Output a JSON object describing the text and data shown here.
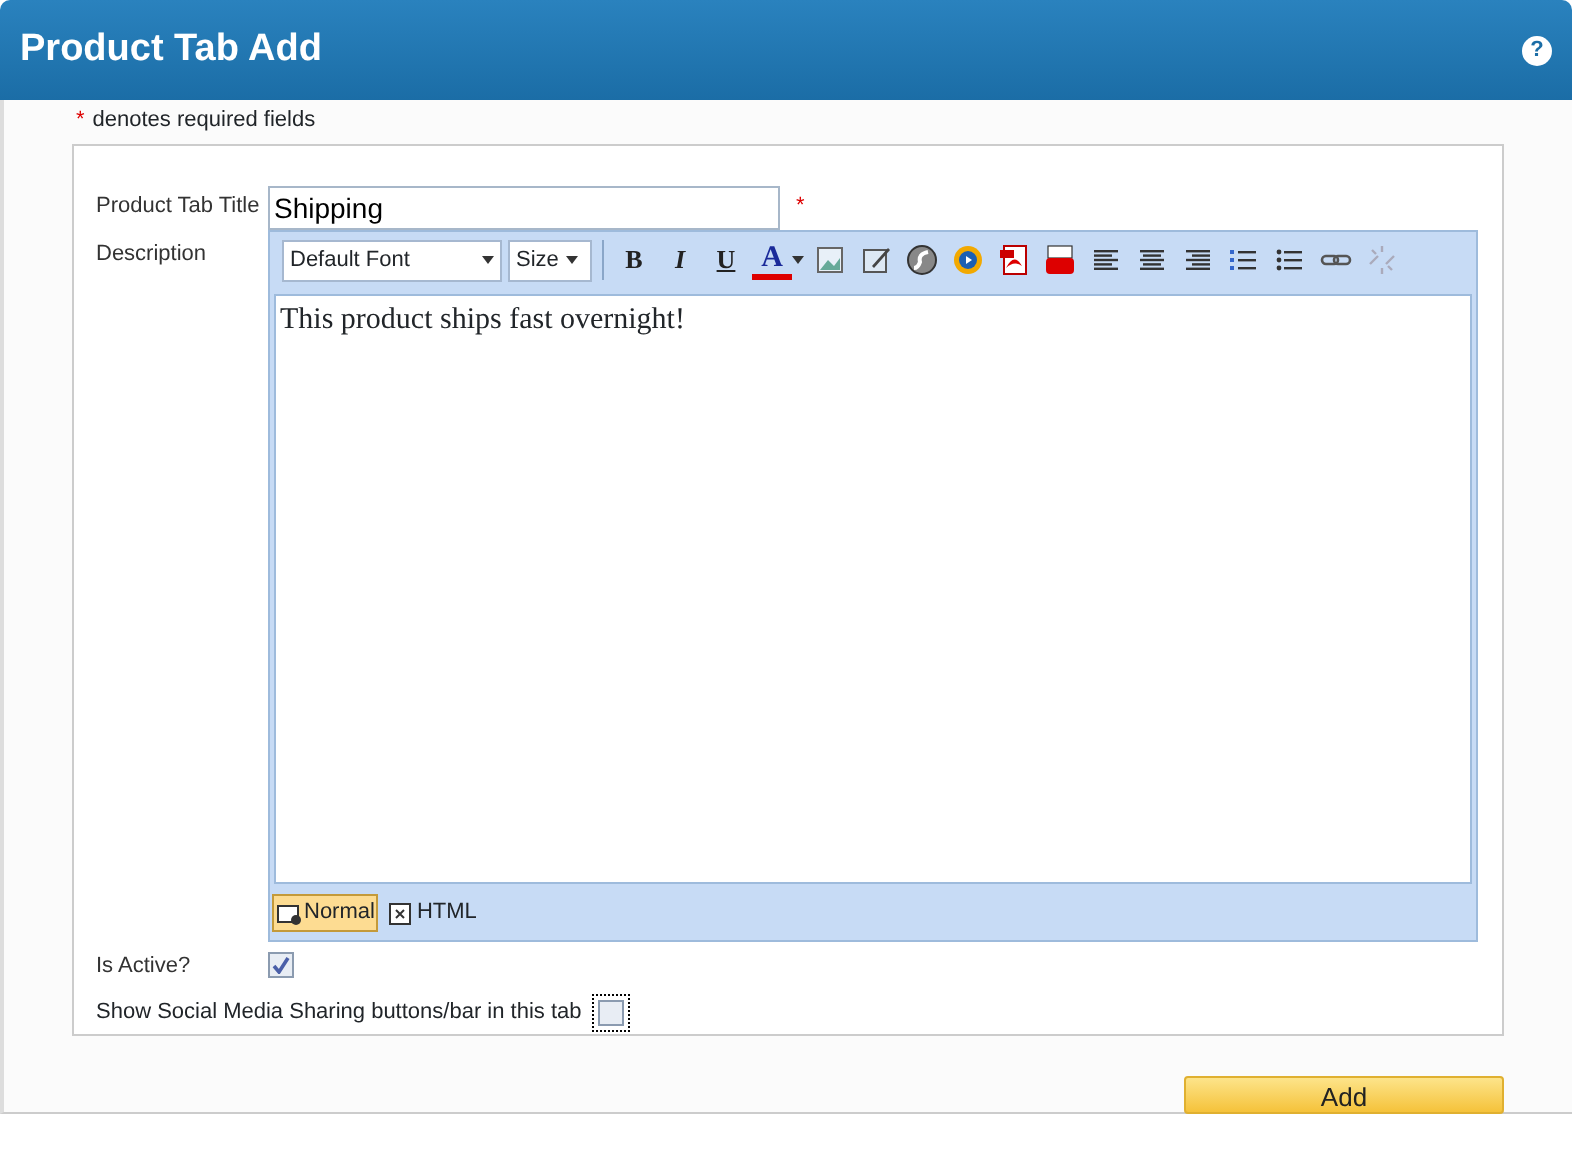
{
  "header": {
    "title": "Product Tab Add",
    "help": "?"
  },
  "required_note": {
    "mark": "*",
    "text": "denotes required fields"
  },
  "form": {
    "title_field": {
      "label": "Product Tab Title",
      "value": "Shipping",
      "required_mark": "*"
    },
    "description": {
      "label": "Description",
      "font_select": "Default Font",
      "size_select": "Size",
      "format_buttons": [
        "B",
        "I",
        "U",
        "A"
      ],
      "content": "This product ships fast overnight!",
      "modes": [
        {
          "label": "Normal",
          "selected": true
        },
        {
          "label": "HTML",
          "selected": false
        }
      ]
    },
    "is_active": {
      "label": "Is Active?",
      "checked": true
    },
    "social": {
      "label": "Show Social Media Sharing buttons/bar in this tab",
      "checked": false
    }
  },
  "submit": "Add"
}
